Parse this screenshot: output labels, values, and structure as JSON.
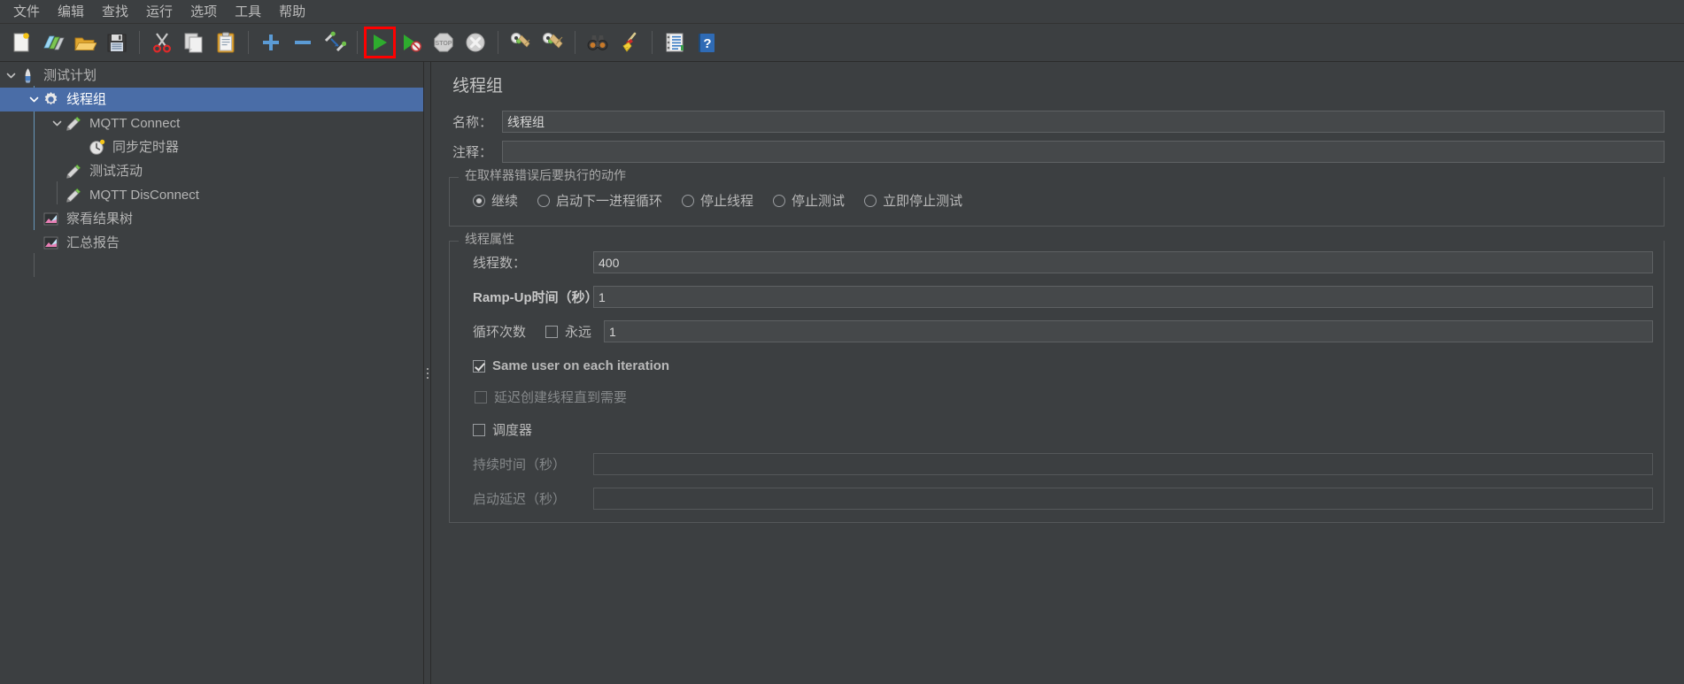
{
  "window": {
    "app": "Apache JMeter",
    "background": "#3c3f41",
    "accent": "#4a6da7",
    "highlight_color": "#ff0000"
  },
  "menubar": {
    "items": [
      {
        "label": "文件",
        "name": "menu-file"
      },
      {
        "label": "编辑",
        "name": "menu-edit"
      },
      {
        "label": "查找",
        "name": "menu-search"
      },
      {
        "label": "运行",
        "name": "menu-run"
      },
      {
        "label": "选项",
        "name": "menu-options"
      },
      {
        "label": "工具",
        "name": "menu-tools"
      },
      {
        "label": "帮助",
        "name": "menu-help"
      }
    ]
  },
  "toolbar": {
    "items": [
      {
        "icon": "new-document-icon",
        "name": "new-test-plan-button"
      },
      {
        "icon": "templates-icon",
        "name": "templates-button"
      },
      {
        "icon": "open-folder-icon",
        "name": "open-button"
      },
      {
        "icon": "save-icon",
        "name": "save-button"
      },
      {
        "icon": "separator",
        "name": "toolbar-separator-1"
      },
      {
        "icon": "scissors-icon",
        "name": "cut-button"
      },
      {
        "icon": "copy-icon",
        "name": "copy-button"
      },
      {
        "icon": "paste-icon",
        "name": "paste-button"
      },
      {
        "icon": "separator",
        "name": "toolbar-separator-2"
      },
      {
        "icon": "plus-icon",
        "name": "expand-all-button"
      },
      {
        "icon": "minus-icon",
        "name": "collapse-all-button"
      },
      {
        "icon": "toggle-icon",
        "name": "toggle-enable-button"
      },
      {
        "icon": "separator",
        "name": "toolbar-separator-3"
      },
      {
        "icon": "play-icon",
        "name": "start-button",
        "highlighted": true
      },
      {
        "icon": "play-no-timers-icon",
        "name": "start-no-pauses-button"
      },
      {
        "icon": "stop-icon",
        "name": "stop-button"
      },
      {
        "icon": "shutdown-icon",
        "name": "shutdown-button"
      },
      {
        "icon": "separator",
        "name": "toolbar-separator-4"
      },
      {
        "icon": "clear-icon",
        "name": "clear-button"
      },
      {
        "icon": "clear-all-icon",
        "name": "clear-all-button"
      },
      {
        "icon": "separator",
        "name": "toolbar-separator-5"
      },
      {
        "icon": "binoculars-icon",
        "name": "search-button"
      },
      {
        "icon": "broom-icon",
        "name": "reset-search-button"
      },
      {
        "icon": "separator",
        "name": "toolbar-separator-6"
      },
      {
        "icon": "function-helper-icon",
        "name": "function-helper-button"
      },
      {
        "icon": "help-icon",
        "name": "help-button"
      }
    ]
  },
  "tree": {
    "nodes": [
      {
        "label": "测试计划",
        "icon": "test-plan-icon",
        "indent": 0,
        "expanded": true,
        "selected": false,
        "name": "tree-node-test-plan"
      },
      {
        "label": "线程组",
        "icon": "thread-group-icon",
        "indent": 1,
        "expanded": true,
        "selected": true,
        "name": "tree-node-thread-group"
      },
      {
        "label": "MQTT Connect",
        "icon": "sampler-icon",
        "indent": 2,
        "expanded": true,
        "selected": false,
        "name": "tree-node-mqtt-connect"
      },
      {
        "label": "同步定时器",
        "icon": "timer-icon",
        "indent": 3,
        "expanded": false,
        "selected": false,
        "name": "tree-node-sync-timer"
      },
      {
        "label": "测试活动",
        "icon": "sampler-icon",
        "indent": 2,
        "expanded": false,
        "selected": false,
        "name": "tree-node-test-action"
      },
      {
        "label": "MQTT DisConnect",
        "icon": "sampler-icon",
        "indent": 2,
        "expanded": false,
        "selected": false,
        "name": "tree-node-mqtt-disconnect"
      },
      {
        "label": "察看结果树",
        "icon": "listener-icon",
        "indent": 1,
        "expanded": false,
        "selected": false,
        "name": "tree-node-view-results-tree"
      },
      {
        "label": "汇总报告",
        "icon": "listener-icon",
        "indent": 1,
        "expanded": false,
        "selected": false,
        "name": "tree-node-summary-report"
      }
    ]
  },
  "panel": {
    "title": "线程组",
    "name_label": "名称：",
    "name_value": "线程组",
    "comment_label": "注释：",
    "comment_value": "",
    "error_action": {
      "group_title": "在取样器错误后要执行的动作",
      "options": [
        {
          "label": "继续",
          "checked": true,
          "name": "radio-continue"
        },
        {
          "label": "启动下一进程循环",
          "checked": false,
          "name": "radio-start-next-loop"
        },
        {
          "label": "停止线程",
          "checked": false,
          "name": "radio-stop-thread"
        },
        {
          "label": "停止测试",
          "checked": false,
          "name": "radio-stop-test"
        },
        {
          "label": "立即停止测试",
          "checked": false,
          "name": "radio-stop-test-now"
        }
      ]
    },
    "thread_properties": {
      "group_title": "线程属性",
      "num_threads_label": "线程数：",
      "num_threads_value": "400",
      "ramp_up_label": "Ramp-Up时间（秒）：",
      "ramp_up_value": "1",
      "loop_count_label": "循环次数",
      "forever_label": "永远",
      "forever_checked": false,
      "loop_count_value": "1",
      "same_user_label": "Same user on each iteration",
      "same_user_checked": true,
      "delay_create_label": "延迟创建线程直到需要",
      "delay_create_checked": false,
      "scheduler_label": "调度器",
      "scheduler_checked": false,
      "duration_label": "持续时间（秒）",
      "duration_value": "",
      "startup_delay_label": "启动延迟（秒）",
      "startup_delay_value": ""
    }
  }
}
